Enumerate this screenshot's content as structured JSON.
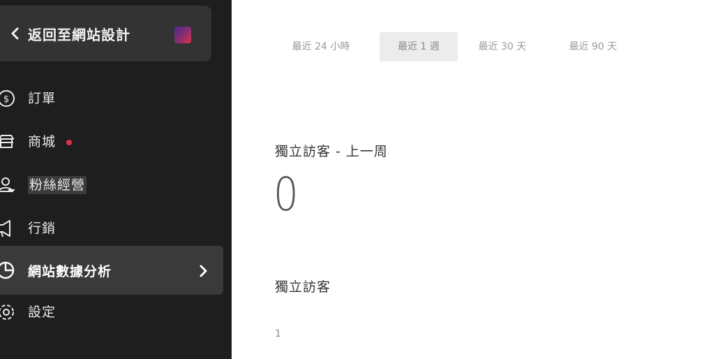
{
  "sidebar": {
    "back_label": "返回至網站設計",
    "items": [
      {
        "label": "訂單",
        "icon": "dollar-circle-icon"
      },
      {
        "label": "商城",
        "icon": "store-icon",
        "has_dot": true
      },
      {
        "label": "粉絲經營",
        "icon": "user-group-icon"
      },
      {
        "label": "行銷",
        "icon": "megaphone-icon"
      },
      {
        "label": "網站數據分析",
        "icon": "pie-chart-icon",
        "active": true
      },
      {
        "label": "設定",
        "icon": "gear-icon"
      }
    ],
    "dot_color": "#e0334a"
  },
  "main": {
    "range_tabs": [
      {
        "label": "最近 24 小時",
        "selected": false
      },
      {
        "label": "最近 1 週",
        "selected": true
      },
      {
        "label": "最近 30 天",
        "selected": false
      },
      {
        "label": "最近 90 天",
        "selected": false
      }
    ],
    "unique_prev_label": "獨立訪客 - 上一周",
    "unique_prev_value": "0",
    "unique_label": "獨立訪客",
    "chart_tick": "1"
  }
}
